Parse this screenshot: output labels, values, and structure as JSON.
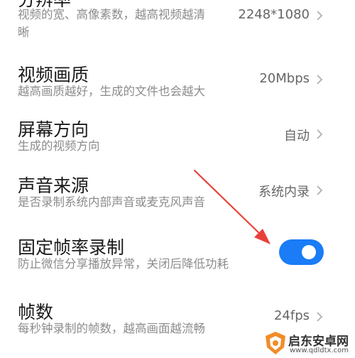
{
  "settings": [
    {
      "title": "分辨率",
      "subtitle_line1": "视频的宽、高像素数，越高视频越清",
      "subtitle_line2": "晰",
      "value": "2248*1080"
    },
    {
      "title": "视频画质",
      "subtitle": "越高画质越好，生成的文件也会越大",
      "value": "20Mbps"
    },
    {
      "title": "屏幕方向",
      "subtitle": "生成的视频方向",
      "value": "自动"
    },
    {
      "title": "声音来源",
      "subtitle": "是否录制系统内部声音或麦克风声音",
      "value": "系统内录"
    },
    {
      "title": "固定帧率录制",
      "subtitle": "防止微信分享播放异常，关闭后降低功耗",
      "toggle_on": true
    },
    {
      "title": "帧数",
      "subtitle": "每秒钟录制的帧数，越高画面越流畅",
      "value": "24fps"
    }
  ],
  "colors": {
    "toggle_on": "#1a7cf6",
    "annotation_arrow": "#e8413a"
  },
  "watermark": {
    "name": "启东安卓网",
    "url": "www.qdldtx.com"
  }
}
